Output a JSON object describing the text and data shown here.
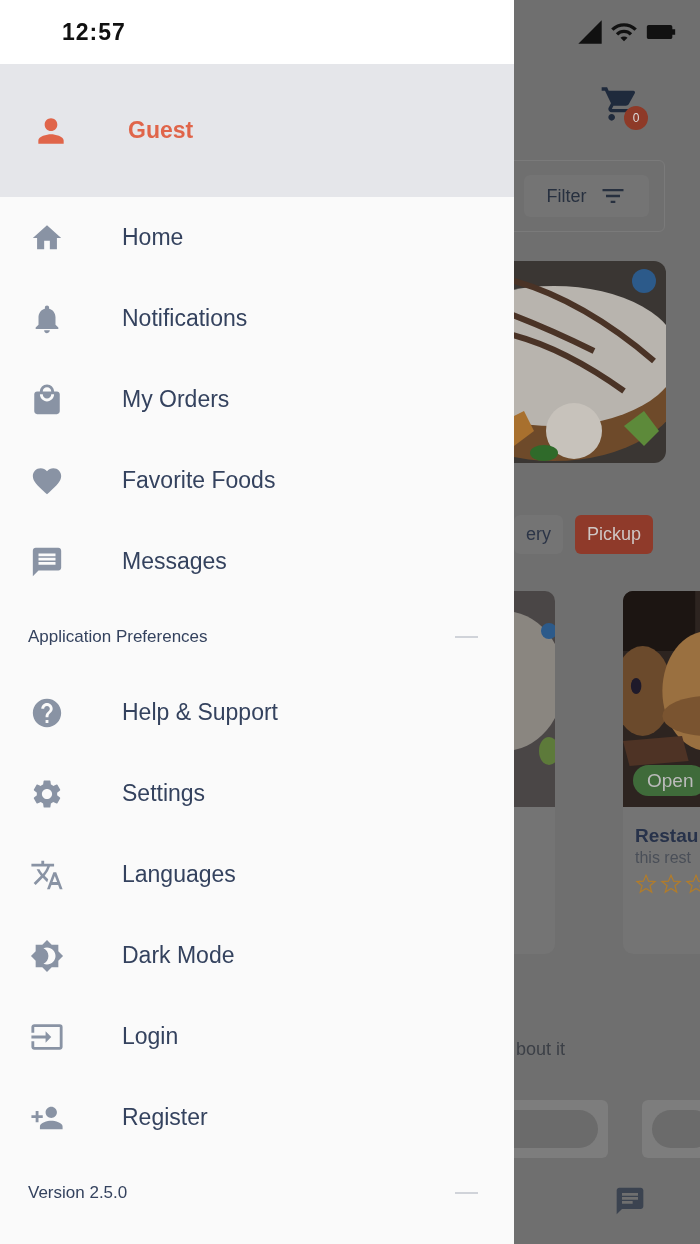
{
  "status_bar": {
    "time": "12:57"
  },
  "drawer": {
    "user": {
      "name": "Guest"
    },
    "menu": [
      {
        "label": "Home"
      },
      {
        "label": "Notifications"
      },
      {
        "label": "My Orders"
      },
      {
        "label": "Favorite Foods"
      },
      {
        "label": "Messages"
      }
    ],
    "preferences": {
      "title": "Application Preferences",
      "items": [
        {
          "label": "Help & Support"
        },
        {
          "label": "Settings"
        },
        {
          "label": "Languages"
        },
        {
          "label": "Dark Mode"
        },
        {
          "label": "Login"
        },
        {
          "label": "Register"
        }
      ]
    },
    "version": "Version 2.5.0"
  },
  "background": {
    "cart_badge": "0",
    "filter_button": "Filter",
    "chips": [
      {
        "label": "ery",
        "selected": false
      },
      {
        "label": "Pickup",
        "selected": true
      }
    ],
    "card": {
      "status": "Open",
      "title": "Restau",
      "description": "this rest",
      "stars": 0
    },
    "text": "bout it"
  }
}
